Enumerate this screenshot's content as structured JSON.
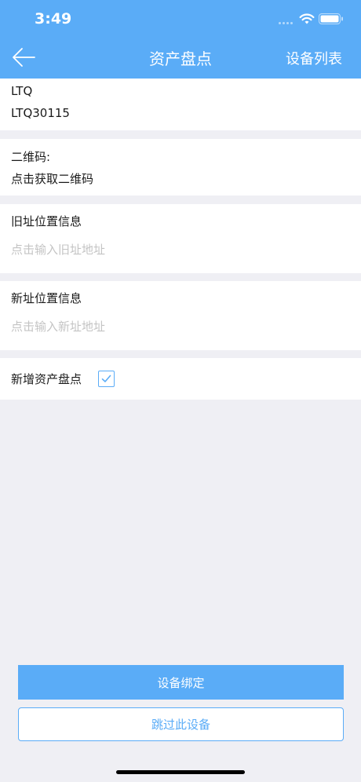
{
  "status_bar": {
    "time": "3:49",
    "icons": [
      "signal-dots-icon",
      "wifi-icon",
      "battery-icon"
    ]
  },
  "nav": {
    "back_icon": "back-arrow-icon",
    "title": "资产盘点",
    "right_action": "设备列表"
  },
  "device": {
    "name": "LTQ",
    "code": "LTQ30115"
  },
  "qrcode": {
    "label": "二维码:",
    "action": "点击获取二维码"
  },
  "old_location": {
    "label": "旧址位置信息",
    "placeholder": "点击输入旧址地址"
  },
  "new_location": {
    "label": "新址位置信息",
    "placeholder": "点击输入新址地址"
  },
  "new_asset": {
    "label": "新增资产盘点",
    "checked": true
  },
  "buttons": {
    "bind": "设备绑定",
    "skip": "跳过此设备"
  },
  "colors": {
    "accent": "#5aacf7",
    "background": "#efeff4",
    "placeholder": "#c4c4c4"
  }
}
